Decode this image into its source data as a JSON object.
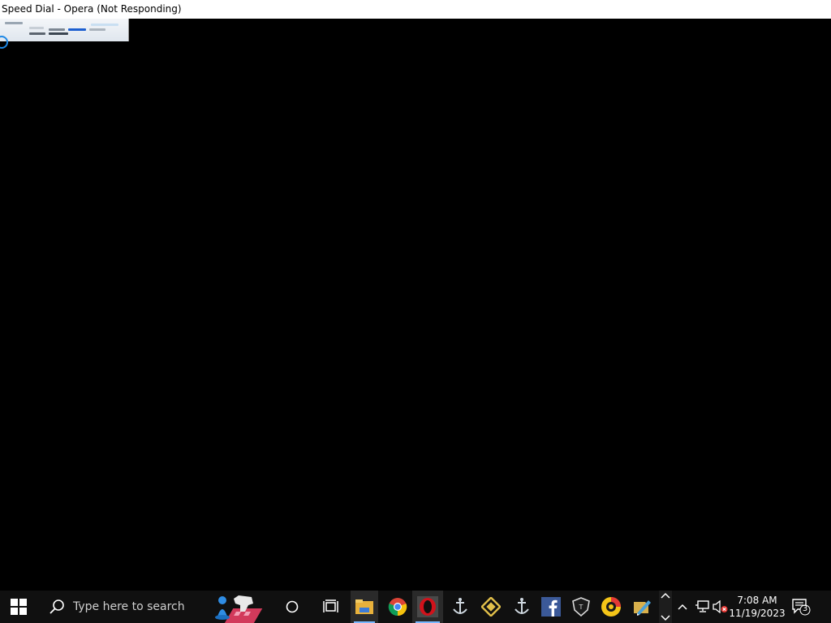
{
  "window": {
    "title": "Speed Dial - Opera (Not Responding)"
  },
  "taskbar": {
    "search_placeholder": "Type here to search",
    "pinned_apps": [
      {
        "name": "file-explorer-icon"
      },
      {
        "name": "chrome-icon"
      },
      {
        "name": "opera-icon"
      },
      {
        "name": "world-of-warships-icon"
      },
      {
        "name": "game-launcher-icon"
      },
      {
        "name": "world-of-warships-icon-2"
      },
      {
        "name": "facebook-icon"
      },
      {
        "name": "world-of-tanks-icon"
      },
      {
        "name": "browser-icon"
      },
      {
        "name": "pencil-app-icon"
      }
    ],
    "clock": {
      "time": "7:08 AM",
      "date": "11/19/2023"
    },
    "notifications": {
      "count": "3"
    }
  }
}
